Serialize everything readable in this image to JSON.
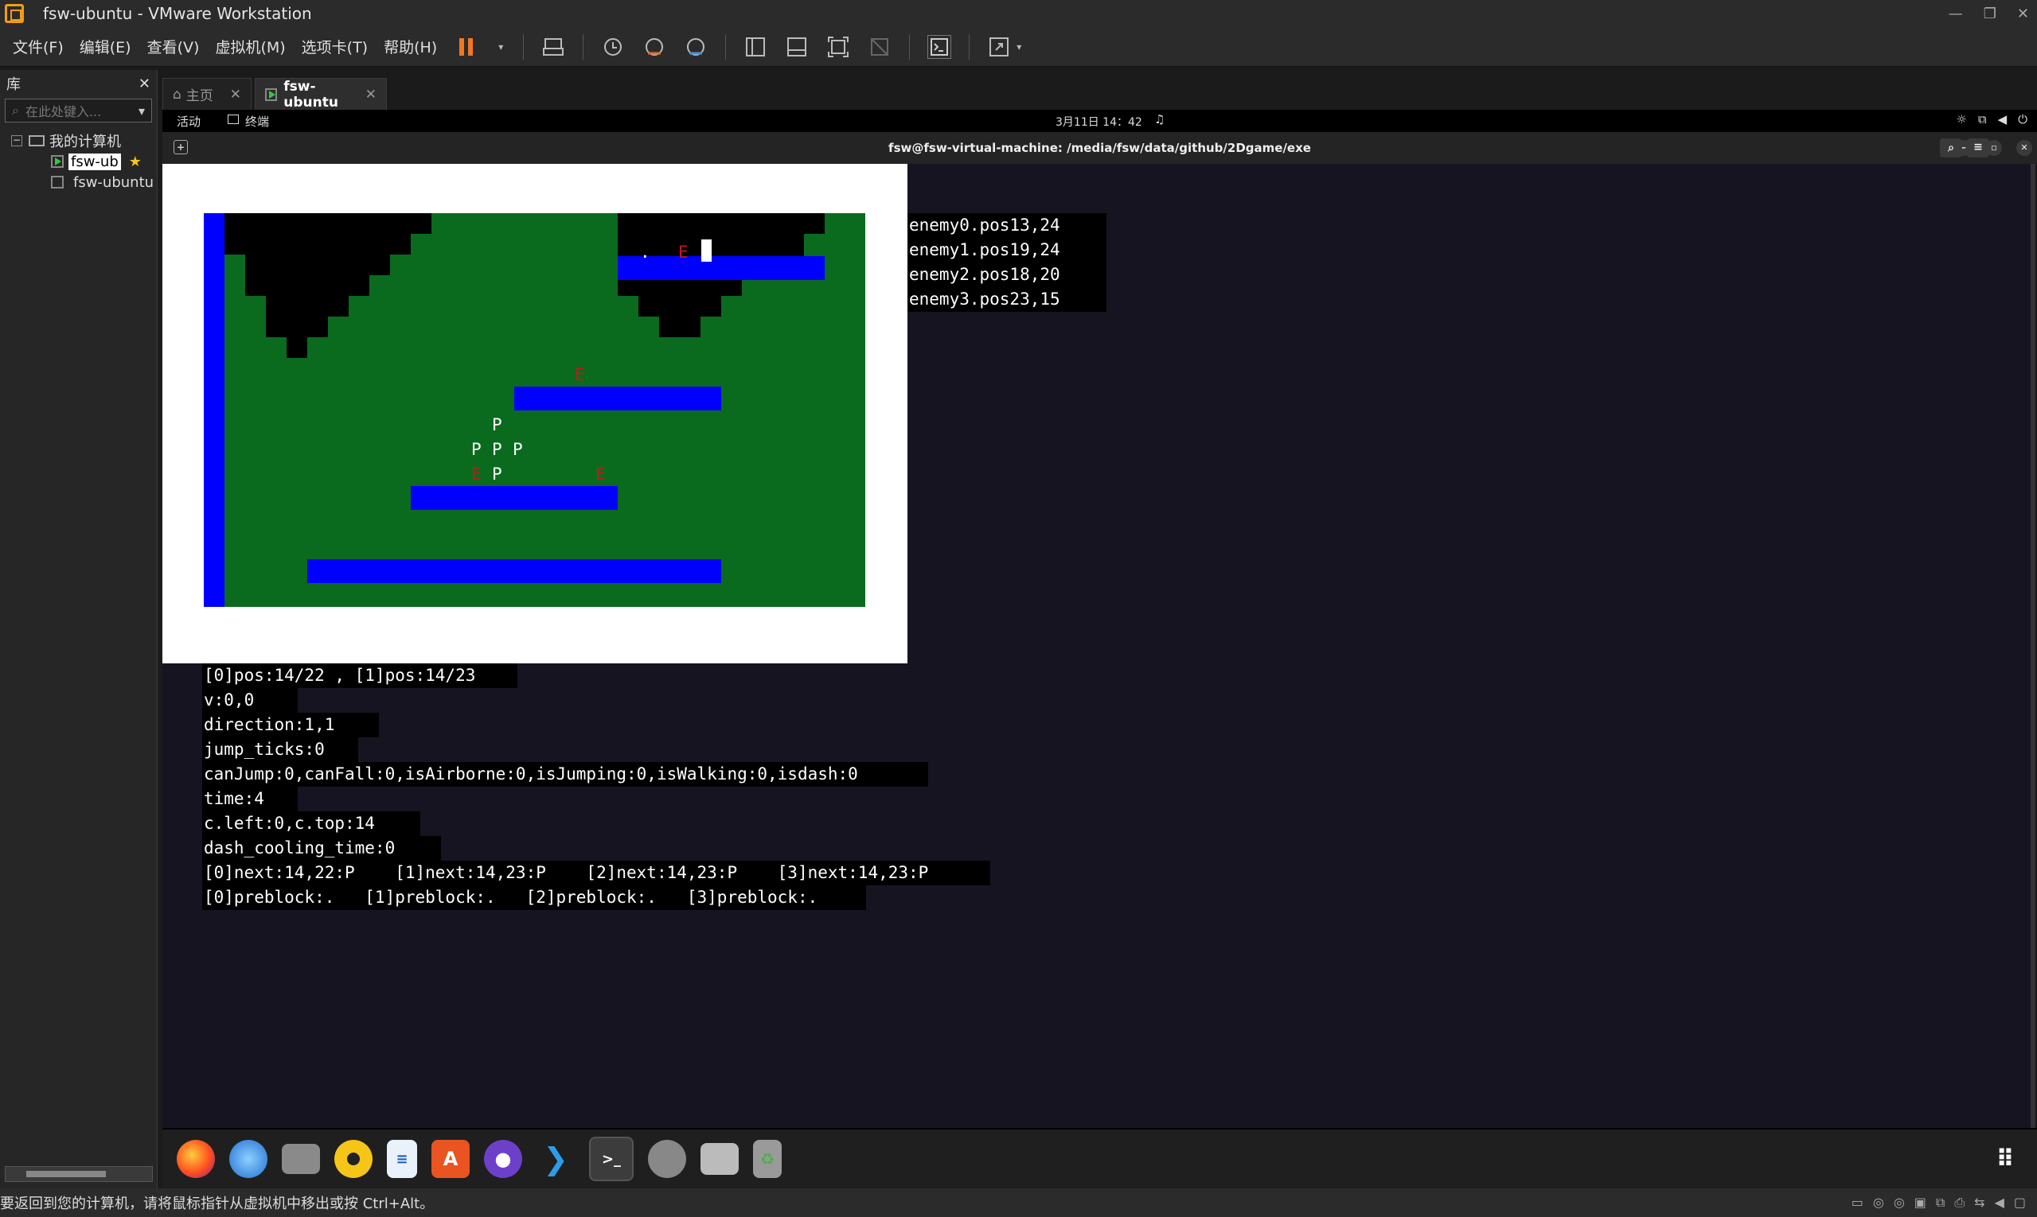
{
  "window": {
    "title": "fsw-ubuntu - VMware Workstation"
  },
  "menu": [
    "文件(F)",
    "编辑(E)",
    "查看(V)",
    "虚拟机(M)",
    "选项卡(T)",
    "帮助(H)"
  ],
  "sidebar": {
    "title": "库",
    "search_placeholder": "在此处键入...",
    "tree": {
      "root": "我的计算机",
      "items": [
        "fsw-ub",
        "fsw-ubuntu"
      ]
    }
  },
  "tabs": [
    {
      "label": "主页"
    },
    {
      "label": "fsw-ubuntu"
    }
  ],
  "guest": {
    "activities": "活动",
    "app_name": "终端",
    "clock": "3月11日 14：42",
    "terminal_title": "fsw@fsw-virtual-machine: /media/fsw/data/github/2Dgame/exe"
  },
  "game": {
    "enemy_glyph": "E",
    "player_glyph": "P",
    "dot_glyph": "."
  },
  "enemy_lines": [
    "enemy0.pos13,24",
    "enemy1.pos19,24",
    "enemy2.pos18,20",
    "enemy3.pos23,15"
  ],
  "debug_lines": [
    "[0]pos:14/22 , [1]pos:14/23",
    "v:0,0",
    "direction:1,1",
    "jump_ticks:0",
    "canJump:0,canFall:0,isAirborne:0,isJumping:0,isWalking:0,isdash:0",
    "time:4",
    "c.left:0,c.top:14",
    "dash_cooling_time:0",
    "[0]next:14,22:P    [1]next:14,23:P    [2]next:14,23:P    [3]next:14,23:P",
    "[0]preblock:.   [1]preblock:.   [2]preblock:.   [3]preblock:."
  ],
  "statusbar": {
    "text": "要返回到您的计算机，请将鼠标指针从虚拟机中移出或按 Ctrl+Alt。"
  },
  "colors": {
    "grass": "#0a6b1e",
    "platform": "#0000ff",
    "cave": "#000000",
    "enemy": "#c8141e"
  }
}
